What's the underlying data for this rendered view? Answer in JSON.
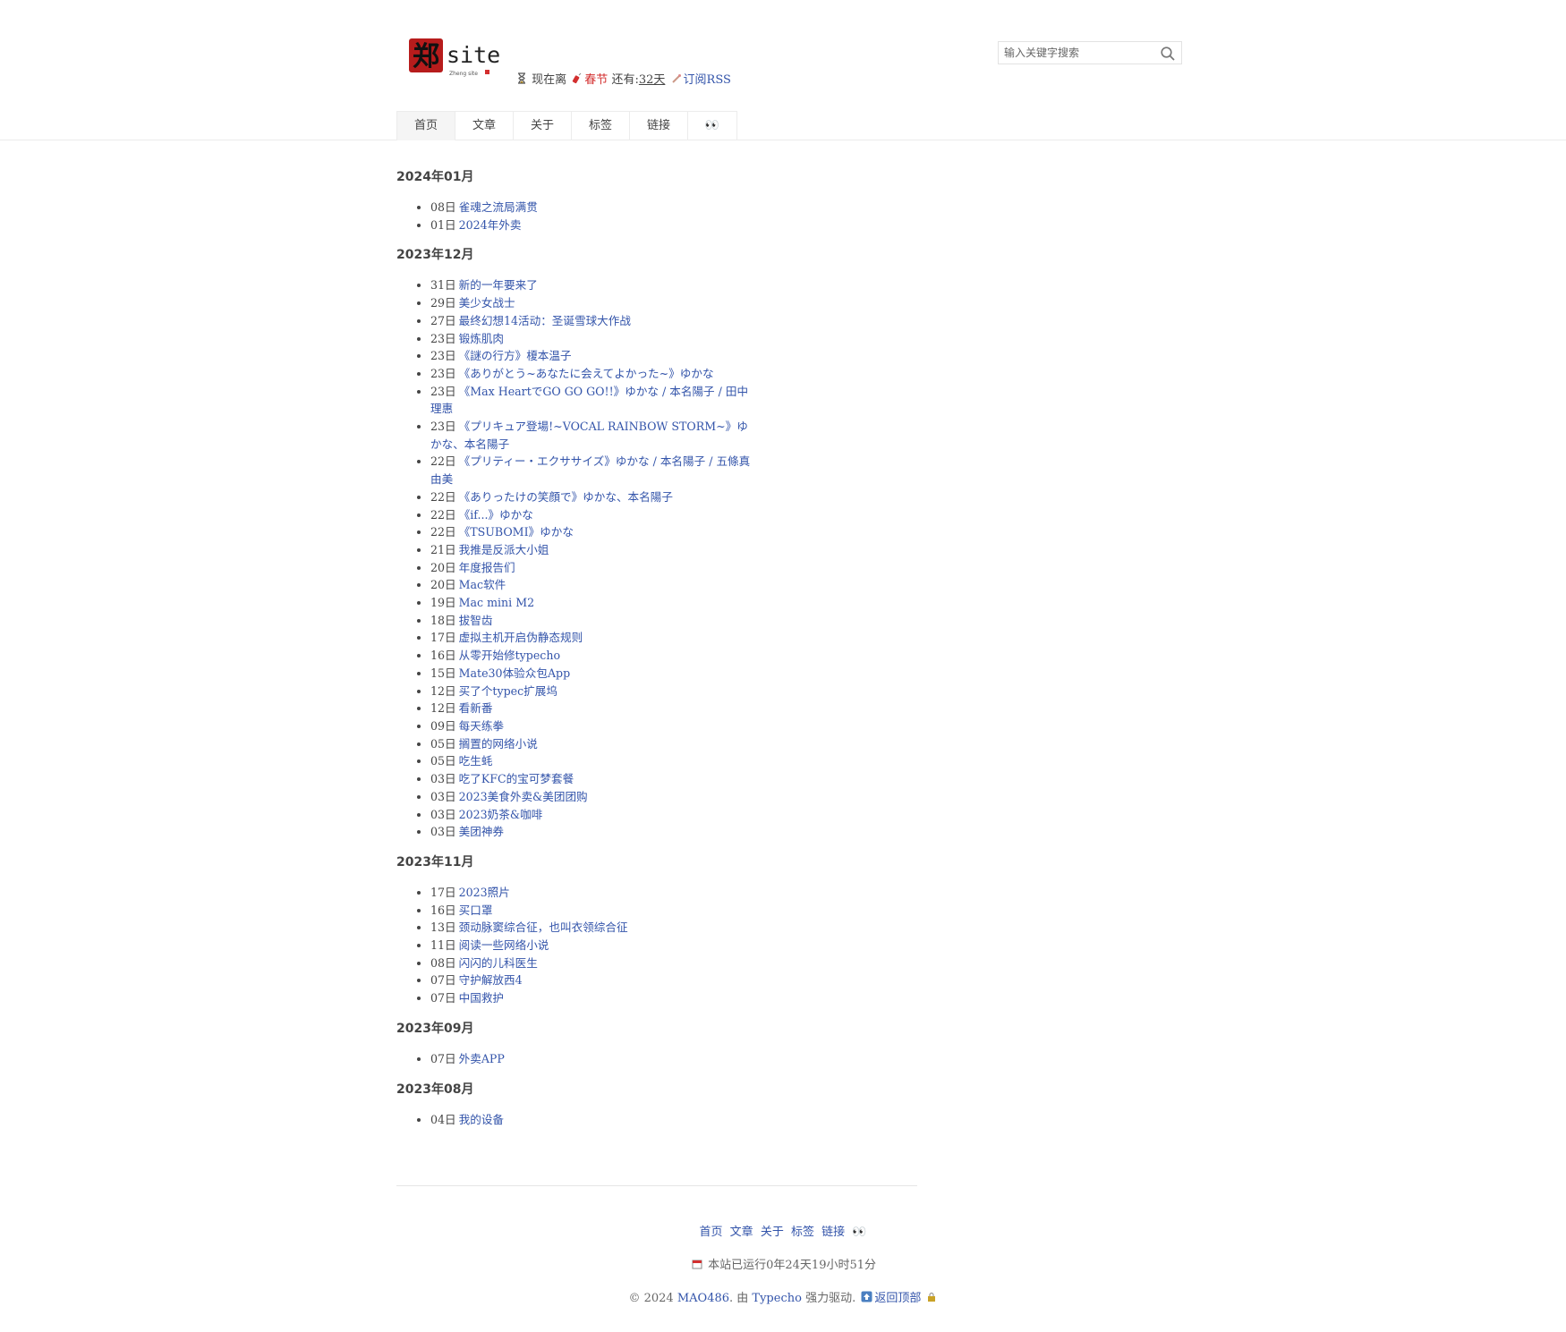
{
  "site": {
    "logo_char": "郑",
    "logo_text": "site",
    "logo_sub": "Zheng site"
  },
  "tagline": {
    "prefix": "现在离",
    "festival": "春节",
    "middle": "还有:",
    "days": "32天",
    "rss": "订阅RSS"
  },
  "search": {
    "placeholder": "输入关键字搜索"
  },
  "nav": [
    {
      "label": "首页"
    },
    {
      "label": "文章"
    },
    {
      "label": "关于"
    },
    {
      "label": "标签"
    },
    {
      "label": "链接"
    },
    {
      "label": "👀"
    }
  ],
  "archive": [
    {
      "month": "2024年01月",
      "posts": [
        {
          "day": "08日",
          "title": "雀魂之流局满贯"
        },
        {
          "day": "01日",
          "title": "2024年外卖"
        }
      ]
    },
    {
      "month": "2023年12月",
      "posts": [
        {
          "day": "31日",
          "title": "新的一年要来了"
        },
        {
          "day": "29日",
          "title": "美少女战士"
        },
        {
          "day": "27日",
          "title": "最终幻想14活动：圣诞雪球大作战"
        },
        {
          "day": "23日",
          "title": "锻炼肌肉"
        },
        {
          "day": "23日",
          "title": "《謎の行方》榎本温子"
        },
        {
          "day": "23日",
          "title": "《ありがとう~あなたに会えてよかった~》ゆかな"
        },
        {
          "day": "23日",
          "title": "《Max HeartでGO GO GO!!》ゆかな / 本名陽子 / 田中理惠"
        },
        {
          "day": "23日",
          "title": "《プリキュア登場!~VOCAL RAINBOW STORM~》ゆかな、本名陽子"
        },
        {
          "day": "22日",
          "title": "《プリティー・エクササイズ》ゆかな / 本名陽子 / 五條真由美"
        },
        {
          "day": "22日",
          "title": "《ありったけの笑顔で》ゆかな、本名陽子"
        },
        {
          "day": "22日",
          "title": "《if...》ゆかな"
        },
        {
          "day": "22日",
          "title": "《TSUBOMI》ゆかな"
        },
        {
          "day": "21日",
          "title": "我推是反派大小姐"
        },
        {
          "day": "20日",
          "title": "年度报告们"
        },
        {
          "day": "20日",
          "title": "Mac软件"
        },
        {
          "day": "19日",
          "title": "Mac mini M2"
        },
        {
          "day": "18日",
          "title": "拔智齿"
        },
        {
          "day": "17日",
          "title": "虚拟主机开启伪静态规则"
        },
        {
          "day": "16日",
          "title": "从零开始修typecho"
        },
        {
          "day": "15日",
          "title": "Mate30体验众包App"
        },
        {
          "day": "12日",
          "title": "买了个typec扩展坞"
        },
        {
          "day": "12日",
          "title": "看新番"
        },
        {
          "day": "09日",
          "title": "每天练拳"
        },
        {
          "day": "05日",
          "title": "搁置的网络小说"
        },
        {
          "day": "05日",
          "title": "吃生蚝"
        },
        {
          "day": "03日",
          "title": "吃了KFC的宝可梦套餐"
        },
        {
          "day": "03日",
          "title": "2023美食外卖&美团团购"
        },
        {
          "day": "03日",
          "title": "2023奶茶&咖啡"
        },
        {
          "day": "03日",
          "title": "美团神券"
        }
      ]
    },
    {
      "month": "2023年11月",
      "posts": [
        {
          "day": "17日",
          "title": "2023照片"
        },
        {
          "day": "16日",
          "title": "买口罩"
        },
        {
          "day": "13日",
          "title": "颈动脉窦综合征，也叫衣领综合征"
        },
        {
          "day": "11日",
          "title": "阅读一些网络小说"
        },
        {
          "day": "08日",
          "title": "闪闪的儿科医生"
        },
        {
          "day": "07日",
          "title": "守护解放西4"
        },
        {
          "day": "07日",
          "title": "中国救护"
        }
      ]
    },
    {
      "month": "2023年09月",
      "posts": [
        {
          "day": "07日",
          "title": "外卖APP"
        }
      ]
    },
    {
      "month": "2023年08月",
      "posts": [
        {
          "day": "04日",
          "title": "我的设备"
        }
      ]
    }
  ],
  "footer": {
    "nav": [
      "首页",
      "文章",
      "关于",
      "标签",
      "链接",
      "👀"
    ],
    "uptime": "本站已运行0年24天19小时51分",
    "copyright": "© 2024",
    "owner": "MAO486",
    "by": ". 由",
    "engine": "Typecho",
    "powered": "强力驱动.",
    "top": "返回顶部"
  }
}
